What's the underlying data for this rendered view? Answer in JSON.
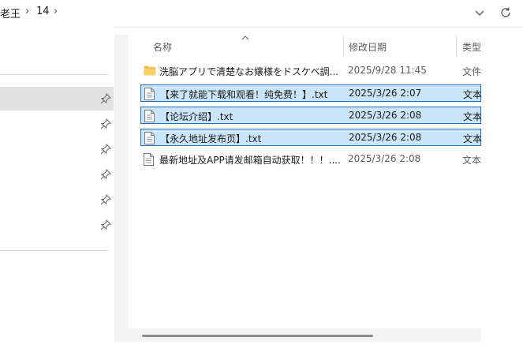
{
  "breadcrumb": {
    "items": [
      "老王",
      "14"
    ]
  },
  "address_bar": {
    "dropdown_icon": "chevron-down-icon",
    "refresh_icon": "refresh-icon"
  },
  "columns": {
    "name": "名称",
    "modified": "修改日期",
    "type": "类型"
  },
  "files": [
    {
      "name": "洗脳アプリで清楚なお嬢様をドスケベ調...",
      "modified": "2025/9/28 11:45",
      "type": "文件",
      "icon": "folder-icon",
      "selected": false
    },
    {
      "name": "【来了就能下载和观看！纯免费！】.txt",
      "modified": "2025/3/26 2:07",
      "type": "文本",
      "icon": "text-file-icon",
      "selected": true
    },
    {
      "name": "【论坛介绍】.txt",
      "modified": "2025/3/26 2:08",
      "type": "文本",
      "icon": "text-file-icon",
      "selected": true
    },
    {
      "name": "【永久地址发布页】.txt",
      "modified": "2025/3/26 2:08",
      "type": "文本",
      "icon": "text-file-icon",
      "selected": true
    },
    {
      "name": "最新地址及APP请发邮箱自动获取！！！....",
      "modified": "2025/3/26 2:08",
      "type": "文本",
      "icon": "text-file-icon",
      "selected": false
    }
  ],
  "colors": {
    "selection_bg": "#cce4f7",
    "selection_border": "#1c6fb8",
    "folder": "#f2c14e"
  }
}
